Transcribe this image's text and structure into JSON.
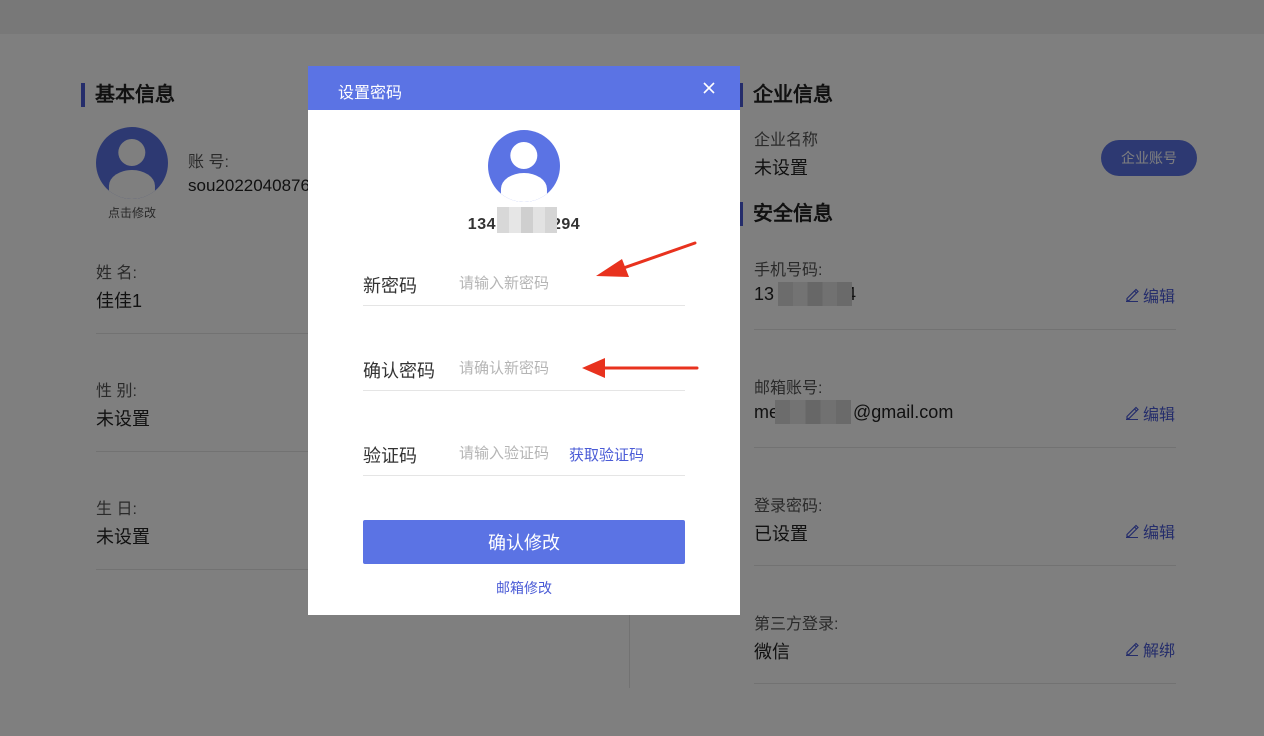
{
  "basic": {
    "title": "基本信息",
    "avatar_caption": "点击修改",
    "account_label": "账 号:",
    "account_value": "sou2022040876",
    "name_label": "姓 名:",
    "name_value": "佳佳1",
    "gender_label": "性 别:",
    "gender_value": "未设置",
    "birthday_label": "生 日:",
    "birthday_value": "未设置"
  },
  "enterprise": {
    "title": "企业信息",
    "name_label": "企业名称",
    "name_value": "未设置",
    "account_button": "企业账号"
  },
  "security": {
    "title": "安全信息",
    "edit_label": "编辑",
    "unbind_label": "解绑",
    "phone_label": "手机号码:",
    "phone_prefix": "13",
    "phone_suffix": "4",
    "email_label": "邮箱账号:",
    "email_prefix": "me",
    "email_suffix": "@gmail.com",
    "password_label": "登录密码:",
    "password_value": "已设置",
    "third_label": "第三方登录:",
    "third_value": "微信"
  },
  "modal": {
    "title": "设置密码",
    "phone_prefix": "134",
    "phone_suffix": "294",
    "new_password_label": "新密码",
    "new_password_placeholder": "请输入新密码",
    "confirm_password_label": "确认密码",
    "confirm_password_placeholder": "请确认新密码",
    "code_label": "验证码",
    "code_placeholder": "请输入验证码",
    "get_code": "获取验证码",
    "confirm_button": "确认修改",
    "email_link": "邮箱修改"
  },
  "colors": {
    "accent": "#5b73e4",
    "link": "#4a5bd6",
    "annotation_arrow": "#e8321e"
  },
  "icons": {
    "close": "close-icon",
    "edit": "pencil-icon",
    "avatar": "user-icon"
  }
}
